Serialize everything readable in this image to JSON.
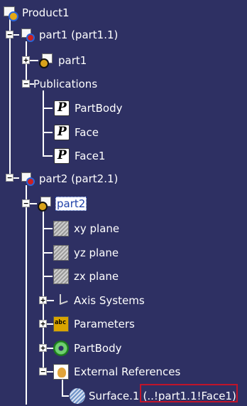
{
  "tree": {
    "product": "Product1",
    "part1_instance": "part1 (part1.1)",
    "part1_part": "part1",
    "publications": "Publications",
    "pub_partbody": "PartBody",
    "pub_face": "Face",
    "pub_face1": "Face1",
    "part2_instance": "part2 (part2.1)",
    "part2_part": "part2",
    "xy_plane": "xy plane",
    "yz_plane": "yz plane",
    "zx_plane": "zx plane",
    "axis_systems": "Axis Systems",
    "parameters": "Parameters",
    "partbody": "PartBody",
    "external_references": "External References",
    "surface": "Surface.1",
    "surface_link": "(..!part1.1!Face1)"
  },
  "colors": {
    "background": "#2e3063",
    "tree_lines": "#ffffff",
    "selection_bg": "#ffffff",
    "selection_text": "#1d3fa8",
    "highlight_box": "#c0142a"
  },
  "icons": {
    "product": "product-icon",
    "instance": "component-instance-icon",
    "part": "part-icon",
    "publication": "publication-icon",
    "plane": "plane-icon",
    "axis": "axis-system-icon",
    "parameters": "parameters-icon",
    "body": "partbody-gear-icon",
    "external": "external-references-icon",
    "surface": "surface-icon"
  }
}
